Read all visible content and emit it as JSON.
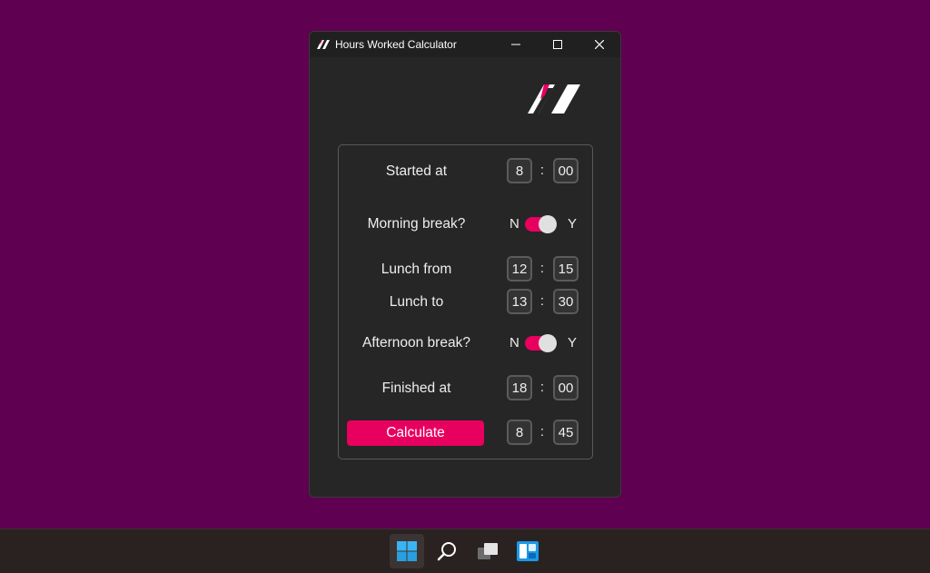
{
  "window": {
    "title": "Hours Worked Calculator"
  },
  "colors": {
    "desktop": "#5f0050",
    "window_bg": "#262626",
    "accent": "#e8005f"
  },
  "calculator": {
    "started": {
      "label": "Started at",
      "hour": "8",
      "minute": "00"
    },
    "morning_break": {
      "label": "Morning break?",
      "off_label": "N",
      "on_label": "Y",
      "value": "Y"
    },
    "lunch_from": {
      "label": "Lunch from",
      "hour": "12",
      "minute": "15"
    },
    "lunch_to": {
      "label": "Lunch to",
      "hour": "13",
      "minute": "30"
    },
    "afternoon_break": {
      "label": "Afternoon break?",
      "off_label": "N",
      "on_label": "Y",
      "value": "Y"
    },
    "finished": {
      "label": "Finished at",
      "hour": "18",
      "minute": "00"
    },
    "calculate_label": "Calculate",
    "result": {
      "hour": "8",
      "minute": "45"
    },
    "separator": ":"
  },
  "taskbar": {
    "icons": [
      "windows-start-icon",
      "search-icon",
      "task-view-icon",
      "widgets-icon"
    ]
  }
}
